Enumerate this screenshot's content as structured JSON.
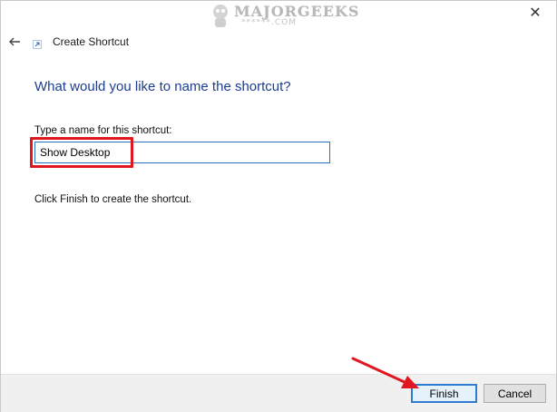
{
  "window": {
    "close_glyph": "✕",
    "title": "Create Shortcut",
    "back_glyph": "←"
  },
  "watermark": {
    "brand": "MAJORGEEKS",
    "sub": "******.COM"
  },
  "wizard": {
    "heading": "What would you like to name the shortcut?",
    "field_label": "Type a name for this shortcut:",
    "name_value": "Show Desktop",
    "info": "Click Finish to create the shortcut."
  },
  "footer": {
    "finish_label": "Finish",
    "cancel_label": "Cancel"
  },
  "colors": {
    "heading": "#1d3d8f",
    "annotation": "#e0171f",
    "focus": "#2a6fc2"
  }
}
